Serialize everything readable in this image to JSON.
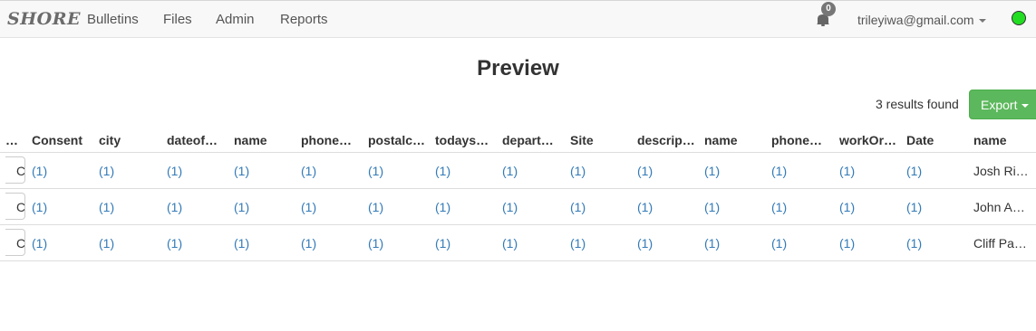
{
  "navbar": {
    "brand": "SHORE",
    "links": [
      "Bulletins",
      "Files",
      "Admin",
      "Reports"
    ],
    "notification_count": "0",
    "user_email": "trileyiwa@gmail.com",
    "status_color": "#22dd22"
  },
  "page": {
    "title": "Preview",
    "results_text": "3 results found",
    "export_label": "Export"
  },
  "table": {
    "headers": [
      "…",
      "Consent",
      "city",
      "dateof…",
      "name",
      "phone…",
      "postalc…",
      "todays…",
      "depart…",
      "Site",
      "descrip…",
      "name",
      "phone…",
      "workOr…",
      "Date",
      "name"
    ],
    "rows": [
      {
        "checkbox_text": "C",
        "values": [
          "(1)",
          "(1)",
          "(1)",
          "(1)",
          "(1)",
          "(1)",
          "(1)",
          "(1)",
          "(1)",
          "(1)",
          "(1)",
          "(1)",
          "(1)",
          "(1)"
        ],
        "name": "Josh Ri…"
      },
      {
        "checkbox_text": "C",
        "values": [
          "(1)",
          "(1)",
          "(1)",
          "(1)",
          "(1)",
          "(1)",
          "(1)",
          "(1)",
          "(1)",
          "(1)",
          "(1)",
          "(1)",
          "(1)",
          "(1)"
        ],
        "name": "John A…"
      },
      {
        "checkbox_text": "C",
        "values": [
          "(1)",
          "(1)",
          "(1)",
          "(1)",
          "(1)",
          "(1)",
          "(1)",
          "(1)",
          "(1)",
          "(1)",
          "(1)",
          "(1)",
          "(1)",
          "(1)"
        ],
        "name": "Cliff Pa…"
      }
    ]
  }
}
